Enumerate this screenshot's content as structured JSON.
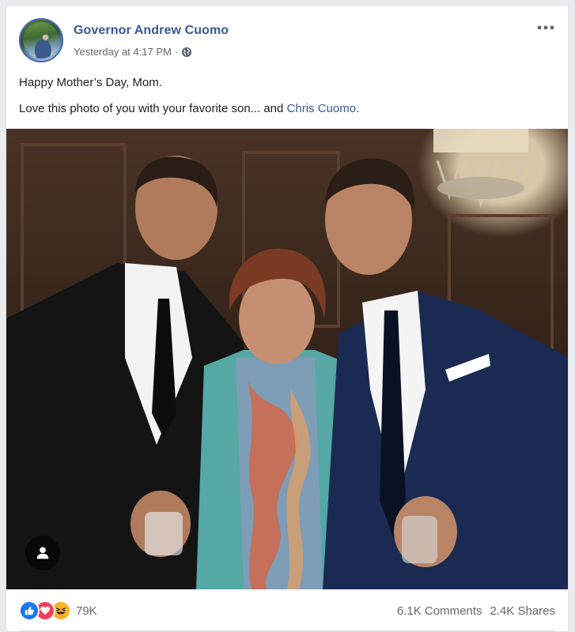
{
  "post": {
    "author": "Governor Andrew Cuomo",
    "timestamp": "Yesterday at 4:17 PM",
    "separator": "·",
    "privacy_icon": "globe-icon",
    "menu_icon": "more-options-icon",
    "text_line1": "Happy Mother’s Day, Mom.",
    "text_line2_prefix": "Love this photo of you with your favorite son... and ",
    "text_line2_link": "Chris Cuomo",
    "text_line2_suffix": "."
  },
  "photo": {
    "badge_icon": "person-tag-icon"
  },
  "footer": {
    "reaction_icons": [
      "like-icon",
      "love-icon",
      "haha-icon"
    ],
    "reaction_count": "79K",
    "comments": "6.1K Comments",
    "shares": "2.4K Shares"
  },
  "colors": {
    "link": "#385898",
    "meta": "#606770",
    "like": "#1877f2",
    "love": "#f33e58",
    "haha": "#f7b125"
  }
}
